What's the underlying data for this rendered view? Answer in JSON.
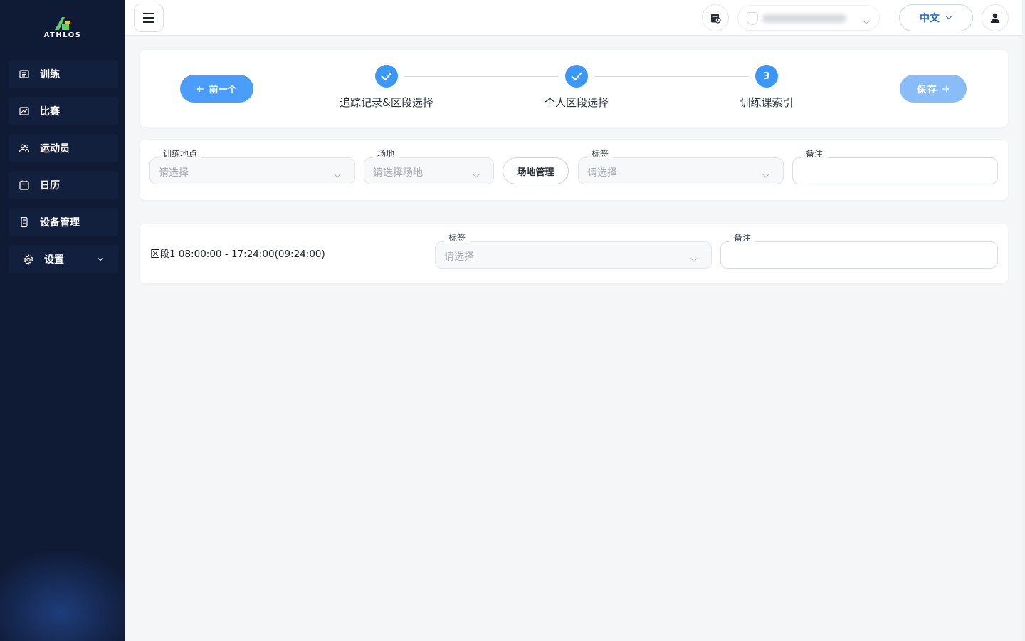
{
  "brand": {
    "name": "ATHLOS"
  },
  "sidebar": {
    "items": [
      {
        "label": "训练",
        "icon": "list-icon"
      },
      {
        "label": "比赛",
        "icon": "chart-icon"
      },
      {
        "label": "运动员",
        "icon": "users-icon"
      },
      {
        "label": "日历",
        "icon": "calendar-icon"
      },
      {
        "label": "设备管理",
        "icon": "device-icon"
      },
      {
        "label": "设置",
        "icon": "gear-icon"
      }
    ]
  },
  "header": {
    "language": "中文"
  },
  "steps": {
    "prev_label": "前一个",
    "save_label": "保存",
    "items": [
      {
        "label": "追踪记录&区段选择",
        "state": "done"
      },
      {
        "label": "个人区段选择",
        "state": "done"
      },
      {
        "label": "训练课索引",
        "state": "active",
        "number": "3"
      }
    ]
  },
  "training_form": {
    "location": {
      "label": "训练地点",
      "placeholder": "请选择"
    },
    "venue": {
      "label": "场地",
      "placeholder": "请选择场地"
    },
    "venue_manage_label": "场地管理",
    "tags": {
      "label": "标签",
      "placeholder": "请选择"
    },
    "notes": {
      "label": "备注",
      "value": ""
    }
  },
  "segment": {
    "title": "区段1 08:00:00 - 17:24:00(09:24:00)",
    "tags": {
      "label": "标签",
      "placeholder": "请选择"
    },
    "notes": {
      "label": "备注",
      "value": ""
    }
  },
  "colors": {
    "primary": "#3b97f8",
    "primary_light": "#88bdf9",
    "sidebar_bg": "#0f1a35",
    "brand_green": "#5ed06b",
    "brand_yellow": "#f5c518"
  }
}
